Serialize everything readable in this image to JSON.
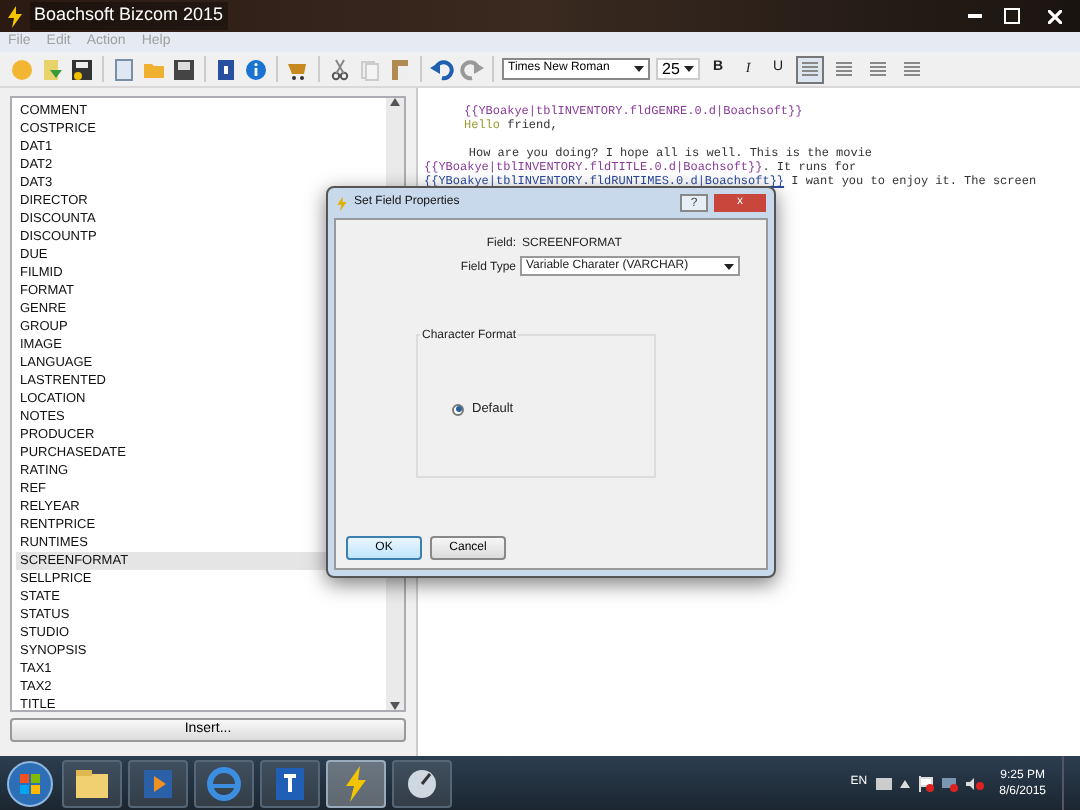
{
  "window": {
    "title": "Boachsoft Bizcom 2015"
  },
  "menu": [
    {
      "label": "File",
      "disabled": true
    },
    {
      "label": "Edit",
      "disabled": true
    },
    {
      "label": "Action",
      "disabled": true
    },
    {
      "label": "Help",
      "disabled": true
    }
  ],
  "toolbar": {
    "font": "Times New Roman",
    "size": "25",
    "format_buttons": [
      "B",
      "I",
      "U"
    ],
    "align": [
      {
        "selected": true
      },
      {
        "selected": false
      },
      {
        "selected": false
      },
      {
        "selected": false
      }
    ]
  },
  "fields": {
    "items": [
      {
        "label": "COMMENT",
        "selected": false
      },
      {
        "label": "COSTPRICE",
        "selected": false
      },
      {
        "label": "DAT1",
        "selected": false
      },
      {
        "label": "DAT2",
        "selected": false
      },
      {
        "label": "DAT3",
        "selected": false
      },
      {
        "label": "DIRECTOR",
        "selected": false
      },
      {
        "label": "DISCOUNTA",
        "selected": false
      },
      {
        "label": "DISCOUNTP",
        "selected": false
      },
      {
        "label": "DUE",
        "selected": false
      },
      {
        "label": "FILMID",
        "selected": false
      },
      {
        "label": "FORMAT",
        "selected": false
      },
      {
        "label": "GENRE",
        "selected": false
      },
      {
        "label": "GROUP",
        "selected": false
      },
      {
        "label": "IMAGE",
        "selected": false
      },
      {
        "label": "LANGUAGE",
        "selected": false
      },
      {
        "label": "LASTRENTED",
        "selected": false
      },
      {
        "label": "LOCATION",
        "selected": false
      },
      {
        "label": "NOTES",
        "selected": false
      },
      {
        "label": "PRODUCER",
        "selected": false
      },
      {
        "label": "PURCHASEDATE",
        "selected": false
      },
      {
        "label": "RATING",
        "selected": false
      },
      {
        "label": "REF",
        "selected": false
      },
      {
        "label": "RELYEAR",
        "selected": false
      },
      {
        "label": "RENTPRICE",
        "selected": false
      },
      {
        "label": "RUNTIMES",
        "selected": false
      },
      {
        "label": "SCREENFORMAT",
        "selected": true
      },
      {
        "label": "SELLPRICE",
        "selected": false
      },
      {
        "label": "STATE",
        "selected": false
      },
      {
        "label": "STATUS",
        "selected": false
      },
      {
        "label": "STUDIO",
        "selected": false
      },
      {
        "label": "SYNOPSIS",
        "selected": false
      },
      {
        "label": "TAX1",
        "selected": false
      },
      {
        "label": "TAX2",
        "selected": false
      },
      {
        "label": "TITLE",
        "selected": false
      }
    ],
    "insert_button": "Insert..."
  },
  "editor": {
    "lines": [
      [
        {
          "kind": "field",
          "text": "{{YBoakye|tblINVENTORY.fldGENRE.0.d|Boachsoft}}"
        }
      ],
      [
        {
          "kind": "greeting",
          "text": "Hello"
        },
        {
          "kind": "plain",
          "text": " friend,"
        }
      ],
      [
        {
          "kind": "plain",
          "text": "    How are you doing? I hope all is well. This is the movie"
        }
      ],
      [
        {
          "kind": "field",
          "text": "{{YBoakye|tblINVENTORY.fldTITLE.0.d|Boachsoft}}"
        },
        {
          "kind": "plain",
          "text": ". It runs for"
        }
      ],
      [
        {
          "kind": "linkfield",
          "text": "{{YBoakye|tblINVENTORY.fldRUNTIMES.0.d|Boachsoft}}"
        },
        {
          "kind": "plain",
          "text": " I want you to enjoy it. The screen"
        }
      ]
    ]
  },
  "dialog": {
    "title": "Set Field Properties",
    "help": "?",
    "close": "x",
    "field_label": "Field:",
    "field_value": "SCREENFORMAT",
    "type_label": "Field Type",
    "type_value": "Variable Charater (VARCHAR)",
    "group_label": "Character Format",
    "options": [
      {
        "label": "Default",
        "selected": true
      }
    ],
    "ok": "OK",
    "cancel": "Cancel"
  },
  "taskbar": {
    "apps": [
      {
        "selected": false
      },
      {
        "selected": false
      },
      {
        "selected": false
      },
      {
        "selected": false
      },
      {
        "selected": true
      },
      {
        "selected": false
      }
    ],
    "language": "EN",
    "time": "9:25 PM",
    "date": "8/6/2015"
  }
}
